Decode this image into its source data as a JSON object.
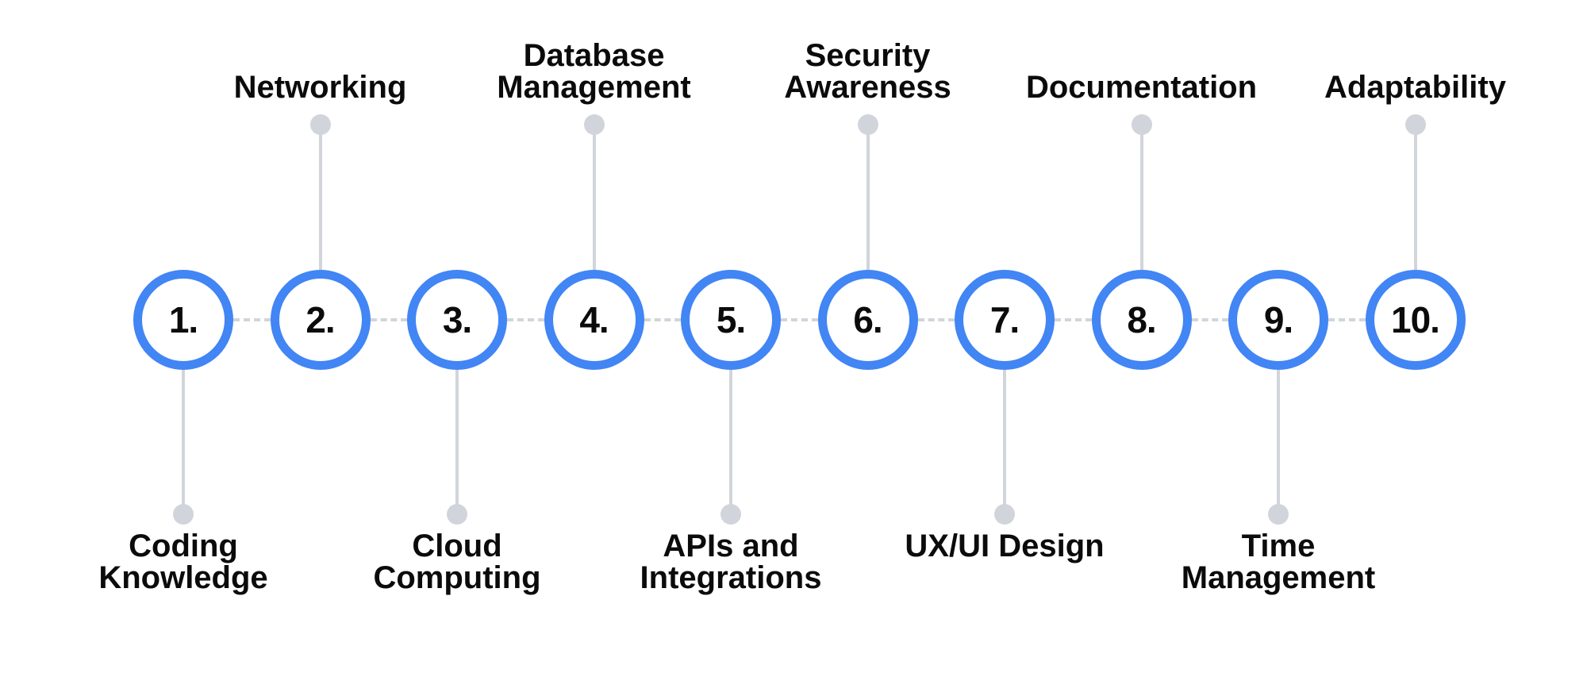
{
  "diagram": {
    "title": "",
    "accent_color": "#4285f4",
    "connector_color": "#d1d5db",
    "steps": [
      {
        "number": "1.",
        "label": "Coding\nKnowledge",
        "position": "below"
      },
      {
        "number": "2.",
        "label": "Networking",
        "position": "above"
      },
      {
        "number": "3.",
        "label": "Cloud\nComputing",
        "position": "below"
      },
      {
        "number": "4.",
        "label": "Database\nManagement",
        "position": "above"
      },
      {
        "number": "5.",
        "label": "APIs and\nIntegrations",
        "position": "below"
      },
      {
        "number": "6.",
        "label": "Security\nAwareness",
        "position": "above"
      },
      {
        "number": "7.",
        "label": "UX/UI Design",
        "position": "below"
      },
      {
        "number": "8.",
        "label": "Documentation",
        "position": "above"
      },
      {
        "number": "9.",
        "label": "Time\nManagement",
        "position": "below"
      },
      {
        "number": "10.",
        "label": "Adaptability",
        "position": "above"
      }
    ]
  }
}
